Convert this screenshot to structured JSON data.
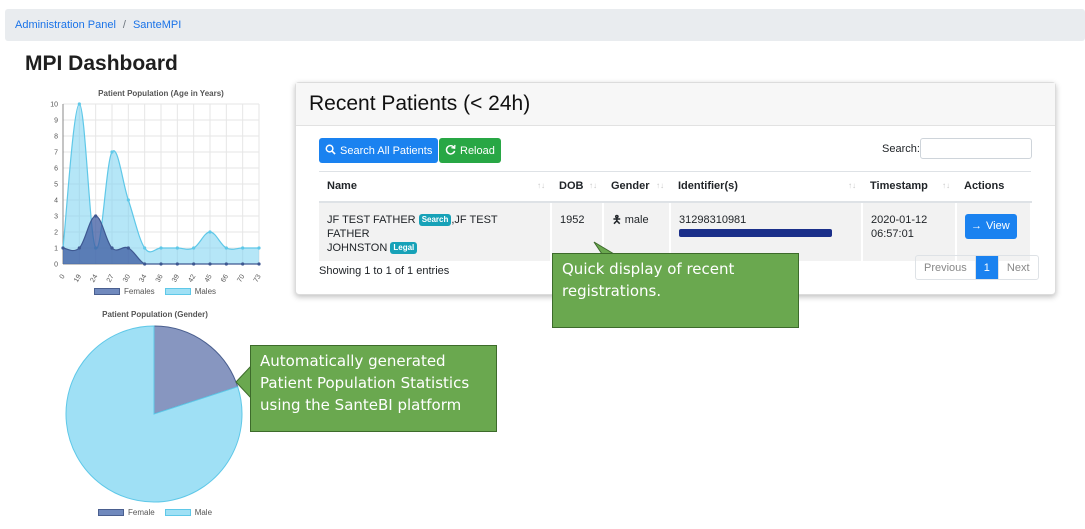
{
  "breadcrumb": {
    "items": [
      "Administration Panel",
      "SanteMPI"
    ]
  },
  "page_title": "MPI Dashboard",
  "age_chart": {
    "title": "Patient Population (Age in Years)",
    "y_ticks": [
      "0",
      "1",
      "2",
      "3",
      "4",
      "5",
      "6",
      "7",
      "8",
      "9",
      "10"
    ],
    "x_ticks": [
      "0",
      "19",
      "24",
      "27",
      "30",
      "34",
      "36",
      "39",
      "42",
      "45",
      "66",
      "70",
      "73"
    ],
    "legend": [
      "Females",
      "Males"
    ]
  },
  "gender_chart": {
    "title": "Patient Population (Gender)",
    "legend": [
      "Female",
      "Male"
    ]
  },
  "chart_data": [
    {
      "type": "area",
      "title": "Patient Population (Age in Years)",
      "categories": [
        "0",
        "19",
        "24",
        "27",
        "30",
        "34",
        "36",
        "39",
        "42",
        "45",
        "66",
        "70",
        "73"
      ],
      "ylim": [
        0,
        10
      ],
      "grid": true,
      "legend_position": "bottom",
      "series": [
        {
          "name": "Females",
          "color": "#7089bd",
          "values": [
            1,
            1,
            3,
            1,
            1,
            0,
            0,
            0,
            0,
            0,
            0,
            0,
            0
          ]
        },
        {
          "name": "Males",
          "color": "#9fe0f5",
          "values": [
            1,
            10,
            1,
            7,
            4,
            1,
            1,
            1,
            1,
            2,
            1,
            1,
            1
          ]
        }
      ]
    },
    {
      "type": "pie",
      "title": "Patient Population (Gender)",
      "legend_position": "bottom",
      "series": [
        {
          "name": "Female",
          "color": "#8796c0",
          "value": 0.2
        },
        {
          "name": "Male",
          "color": "#9fe0f5",
          "value": 0.8
        }
      ]
    }
  ],
  "card": {
    "title": "Recent Patients (< 24h)",
    "search_all_label": "Search All Patients",
    "reload_label": "Reload",
    "search_label": "Search:",
    "columns": [
      "Name",
      "DOB",
      "Gender",
      "Identifier(s)",
      "Timestamp",
      "Actions"
    ],
    "row": {
      "name_part1": "JF TEST FATHER",
      "badge_search": "Search",
      "name_part2": ",JF TEST FATHER",
      "name_part3": "JOHNSTON",
      "badge_legal": "Legal",
      "dob": "1952",
      "gender": "male",
      "identifier": "31298310981",
      "timestamp_date": "2020-01-12",
      "timestamp_time": "06:57:01",
      "view_label": "View"
    },
    "showing": "Showing 1 to 1 of 1 entries",
    "pager": {
      "previous": "Previous",
      "page": "1",
      "next": "Next"
    }
  },
  "callouts": {
    "recent": "Quick display of recent registrations.",
    "stats": "Automatically generated Patient Population Statistics using the SanteBI platform"
  },
  "colors": {
    "primary": "#1a82f0",
    "success": "#28a745",
    "callout": "#6aa84f"
  }
}
